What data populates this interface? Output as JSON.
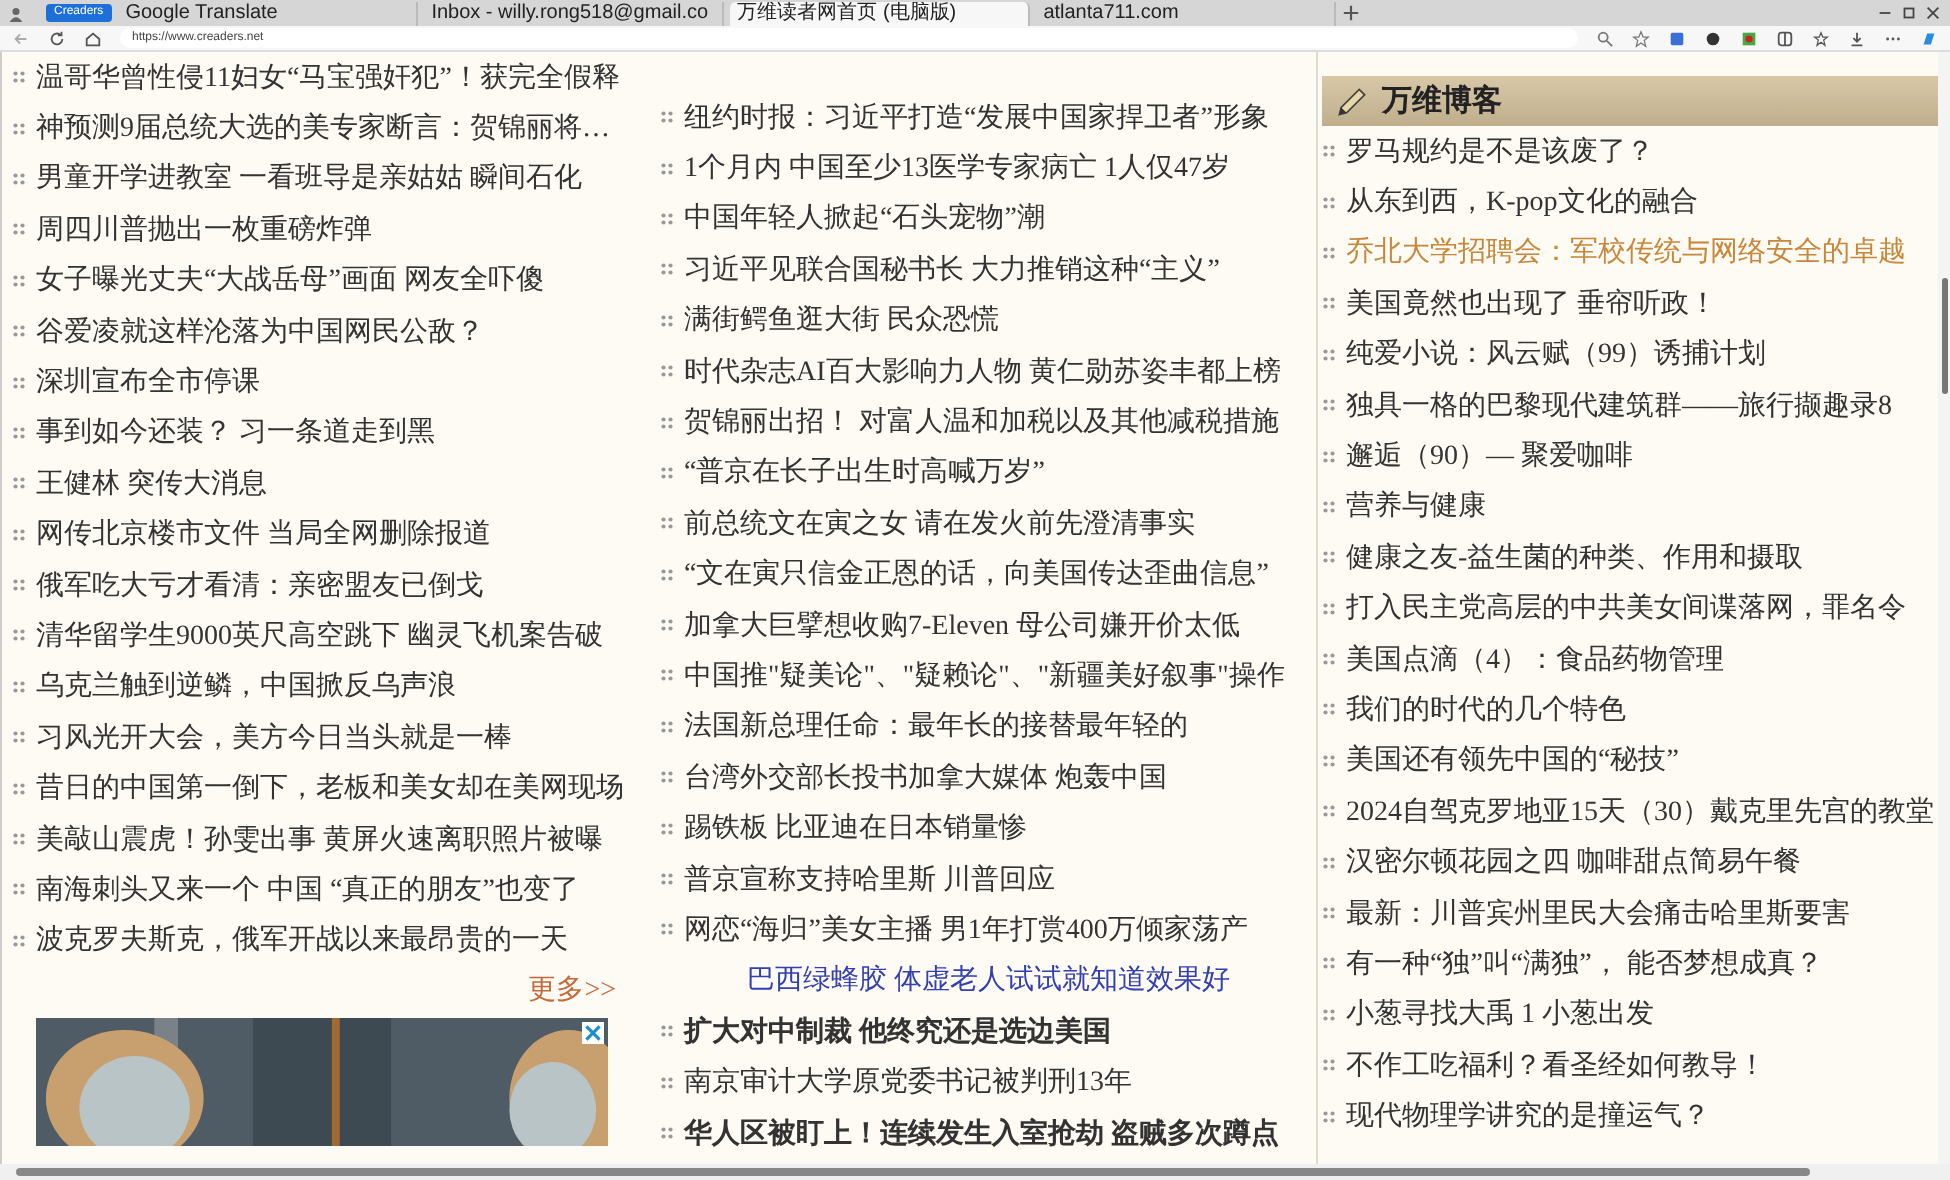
{
  "browser": {
    "tabs": [
      {
        "kind": "pinned",
        "label": "Creaders",
        "selected": false
      },
      {
        "kind": "tab",
        "label": "Google Translate",
        "selected": false
      },
      {
        "kind": "tab",
        "label": "Inbox - willy.rong518@gmail.co",
        "selected": false
      },
      {
        "kind": "tab",
        "label": "万维读者网首页 (电脑版)",
        "selected": true
      },
      {
        "kind": "tab",
        "label": "atlanta711.com",
        "selected": false
      }
    ],
    "url": "https://www.creaders.net"
  },
  "left_column": {
    "items": [
      "温哥华曾性侵11妇女“马宝强奸犯”！获完全假释",
      "神预测9届总统大选的美专家断言：贺锦丽将…",
      "男童开学进教室 一看班导是亲姑姑 瞬间石化",
      "周四川普抛出一枚重磅炸弹",
      "女子曝光丈夫“大战岳母”画面 网友全吓傻",
      "谷爱凌就这样沦落为中国网民公敌？",
      "深圳宣布全市停课",
      "事到如今还装？ 习一条道走到黑",
      "王健林 突传大消息",
      "网传北京楼市文件 当局全网删除报道",
      "俄军吃大亏才看清：亲密盟友已倒戈",
      "清华留学生9000英尺高空跳下 幽灵飞机案告破",
      "乌克兰触到逆鳞，中国掀反乌声浪",
      "习风光开大会，美方今日当头就是一棒",
      "昔日的中国第一倒下，老板和美女却在美网现场",
      "美敲山震虎！孙雯出事 黄屏火速离职照片被曝",
      "南海刺头又来一个 中国 “真正的朋友”也变了",
      "波克罗夫斯克，俄军开战以来最昂贵的一天"
    ],
    "more": "更多>>"
  },
  "middle_column": {
    "items": [
      {
        "kind": "news",
        "text": "纽约时报：习近平打造“发展中国家捍卫者”形象",
        "bold": false
      },
      {
        "kind": "news",
        "text": "1个月内 中国至少13医学专家病亡 1人仅47岁",
        "bold": false
      },
      {
        "kind": "news",
        "text": "中国年轻人掀起“石头宠物”潮",
        "bold": false
      },
      {
        "kind": "news",
        "text": "习近平见联合国秘书长 大力推销这种“主义”",
        "bold": false
      },
      {
        "kind": "news",
        "text": "满街鳄鱼逛大街 民众恐慌",
        "bold": false
      },
      {
        "kind": "news",
        "text": "时代杂志AI百大影响力人物 黄仁勋苏姿丰都上榜",
        "bold": false
      },
      {
        "kind": "news",
        "text": "贺锦丽出招！ 对富人温和加税以及其他减税措施",
        "bold": false
      },
      {
        "kind": "news",
        "text": "“普京在长子出生时高喊万岁”",
        "bold": false
      },
      {
        "kind": "news",
        "text": "前总统文在寅之女 请在发火前先澄清事实",
        "bold": false
      },
      {
        "kind": "news",
        "text": "“文在寅只信金正恩的话，向美国传达歪曲信息”",
        "bold": false
      },
      {
        "kind": "news",
        "text": "加拿大巨擘想收购7-Eleven 母公司嫌开价太低",
        "bold": false
      },
      {
        "kind": "news",
        "text": "中国推\"疑美论\"、\"疑赖论\"、\"新疆美好叙事\"操作",
        "bold": false
      },
      {
        "kind": "news",
        "text": "法国新总理任命：最年长的接替最年轻的",
        "bold": false
      },
      {
        "kind": "news",
        "text": "台湾外交部长投书加拿大媒体 炮轰中国",
        "bold": false
      },
      {
        "kind": "news",
        "text": "踢铁板 比亚迪在日本销量惨",
        "bold": false
      },
      {
        "kind": "news",
        "text": "普京宣称支持哈里斯 川普回应",
        "bold": false
      },
      {
        "kind": "news",
        "text": "网恋“海归”美女主播 男1年打赏400万倾家荡产",
        "bold": false
      },
      {
        "kind": "ad",
        "text": "巴西绿蜂胶 体虚老人试试就知道效果好",
        "bold": false
      },
      {
        "kind": "news",
        "text": "扩大对中制裁 他终究还是选边美国",
        "bold": true
      },
      {
        "kind": "news",
        "text": "南京审计大学原党委书记被判刑13年",
        "bold": false
      },
      {
        "kind": "news",
        "text": "华人区被盯上！连续发生入室抢劫 盗贼多次蹲点",
        "bold": true
      }
    ]
  },
  "right_column": {
    "title": "万维博客",
    "items": [
      {
        "text": "罗马规约是不是该废了？",
        "highlighted": false
      },
      {
        "text": "从东到西，K-pop文化的融合",
        "highlighted": false
      },
      {
        "text": "乔北大学招聘会：军校传统与网络安全的卓越",
        "highlighted": true
      },
      {
        "text": "美国竟然也出现了 垂帘听政！",
        "highlighted": false
      },
      {
        "text": "纯爱小说：风云赋（99）诱捕计划",
        "highlighted": false
      },
      {
        "text": "独具一格的巴黎现代建筑群——旅行撷趣录8",
        "highlighted": false
      },
      {
        "text": "邂逅（90）— 聚爱咖啡",
        "highlighted": false
      },
      {
        "text": "营养与健康",
        "highlighted": false
      },
      {
        "text": "健康之友-益生菌的种类、作用和摄取",
        "highlighted": false
      },
      {
        "text": "打入民主党高层的中共美女间谍落网，罪名令",
        "highlighted": false
      },
      {
        "text": "美国点滴（4）：食品药物管理",
        "highlighted": false
      },
      {
        "text": "我们的时代的几个特色",
        "highlighted": false
      },
      {
        "text": "美国还有领先中国的“秘技”",
        "highlighted": false
      },
      {
        "text": "2024自驾克罗地亚15天（30）戴克里先宫的教堂",
        "highlighted": false
      },
      {
        "text": "汉密尔顿花园之四 咖啡甜点简易午餐",
        "highlighted": false
      },
      {
        "text": "最新：川普宾州里民大会痛击哈里斯要害",
        "highlighted": false
      },
      {
        "text": "有一种“独”叫“满独”， 能否梦想成真？",
        "highlighted": false
      },
      {
        "text": "小葱寻找大禹 1 小葱出发",
        "highlighted": false
      },
      {
        "text": "不作工吃福利？看圣经如何教导！",
        "highlighted": false
      },
      {
        "text": "现代物理学讲究的是撞运气？",
        "highlighted": false
      }
    ]
  }
}
